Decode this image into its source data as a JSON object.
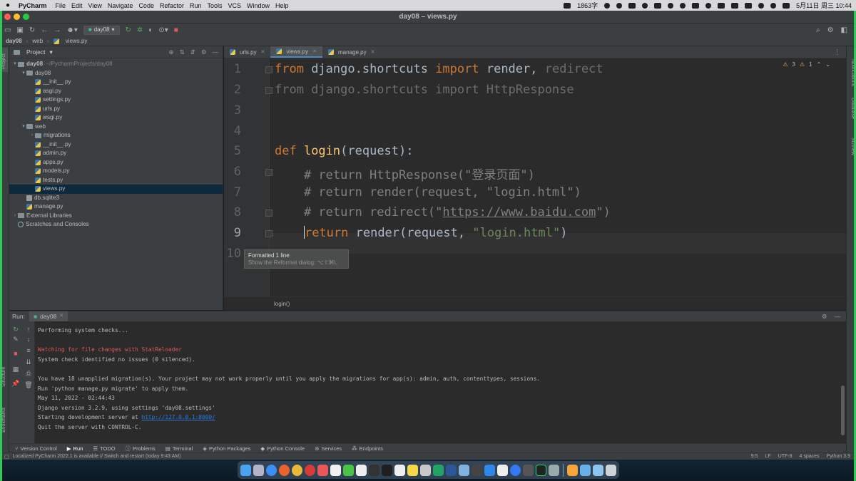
{
  "menubar": {
    "app": "PyCharm",
    "items": [
      "File",
      "Edit",
      "View",
      "Navigate",
      "Code",
      "Refactor",
      "Run",
      "Tools",
      "VCS",
      "Window",
      "Help"
    ],
    "memory": "1863字",
    "datetime": "5月11日 周三 10:44"
  },
  "window": {
    "title": "day08 – views.py"
  },
  "toolbar": {
    "run_config": "day08"
  },
  "breadcrumb": [
    "day08",
    "web",
    "views.py"
  ],
  "project_panel": {
    "title": "Project",
    "tree": [
      {
        "label": "day08",
        "hint": "~/PycharmProjects/day08",
        "depth": 0,
        "kind": "folder",
        "open": true,
        "bold": true
      },
      {
        "label": "day08",
        "hint": "",
        "depth": 1,
        "kind": "folder",
        "open": true
      },
      {
        "label": "__init__.py",
        "hint": "",
        "depth": 2,
        "kind": "py"
      },
      {
        "label": "asgi.py",
        "hint": "",
        "depth": 2,
        "kind": "py"
      },
      {
        "label": "settings.py",
        "hint": "",
        "depth": 2,
        "kind": "py"
      },
      {
        "label": "urls.py",
        "hint": "",
        "depth": 2,
        "kind": "py"
      },
      {
        "label": "wsgi.py",
        "hint": "",
        "depth": 2,
        "kind": "py"
      },
      {
        "label": "web",
        "hint": "",
        "depth": 1,
        "kind": "folder",
        "open": true
      },
      {
        "label": "migrations",
        "hint": "",
        "depth": 2,
        "kind": "folder",
        "open": false
      },
      {
        "label": "__init__.py",
        "hint": "",
        "depth": 2,
        "kind": "py"
      },
      {
        "label": "admin.py",
        "hint": "",
        "depth": 2,
        "kind": "py"
      },
      {
        "label": "apps.py",
        "hint": "",
        "depth": 2,
        "kind": "py"
      },
      {
        "label": "models.py",
        "hint": "",
        "depth": 2,
        "kind": "py"
      },
      {
        "label": "tests.py",
        "hint": "",
        "depth": 2,
        "kind": "py"
      },
      {
        "label": "views.py",
        "hint": "",
        "depth": 2,
        "kind": "py",
        "selected": true
      },
      {
        "label": "db.sqlite3",
        "hint": "",
        "depth": 1,
        "kind": "db"
      },
      {
        "label": "manage.py",
        "hint": "",
        "depth": 1,
        "kind": "py"
      },
      {
        "label": "External Libraries",
        "hint": "",
        "depth": 0,
        "kind": "lib",
        "open": false
      },
      {
        "label": "Scratches and Consoles",
        "hint": "",
        "depth": 0,
        "kind": "scratch"
      }
    ]
  },
  "editor": {
    "tabs": [
      {
        "label": "urls.py",
        "active": false
      },
      {
        "label": "views.py",
        "active": true
      },
      {
        "label": "manage.py",
        "active": false
      }
    ],
    "warnings": "3",
    "weak_warnings": "1",
    "line_numbers": [
      "1",
      "2",
      "3",
      "4",
      "5",
      "6",
      "7",
      "8",
      "9",
      "10"
    ],
    "current_line": "9",
    "code": {
      "l1_from": "from",
      "l1_mod": " django.shortcuts ",
      "l1_import": "import",
      "l1_render": " render,",
      "l1_redirect": " redirect",
      "l2": "from django.shortcuts import HttpResponse",
      "l5_def": "def",
      "l5_name": " login",
      "l5_args": "(request):",
      "l6": "    # return HttpResponse(\"登录页面\")",
      "l7": "    # return render(request, \"login.html\")",
      "l8_pre": "    # return redirect(\"",
      "l8_url": "https://www.baidu.com",
      "l8_post": "\")",
      "l9_return": "return",
      "l9_call": " render(request, ",
      "l9_str": "\"login.html\"",
      "l9_close": ")"
    },
    "tooltip": {
      "title": "Formatted 1 line",
      "hint": "Show the Reformat dialog: ⌥⇧⌘L"
    },
    "breadcrumb": "login()"
  },
  "run_panel": {
    "label": "Run:",
    "tab": "day08",
    "lines": [
      {
        "text": "Performing system checks...",
        "style": "normal"
      },
      {
        "text": "",
        "style": "normal"
      },
      {
        "text": "Watching for file changes with StatReloader",
        "style": "red"
      },
      {
        "text": "System check identified no issues (0 silenced).",
        "style": "normal"
      },
      {
        "text": "",
        "style": "normal"
      },
      {
        "text": "You have 18 unapplied migration(s). Your project may not work properly until you apply the migrations for app(s): admin, auth, contenttypes, sessions.",
        "style": "normal"
      },
      {
        "text": "Run 'python manage.py migrate' to apply them.",
        "style": "normal"
      },
      {
        "text": "May 11, 2022 - 02:44:43",
        "style": "normal"
      },
      {
        "text": "Django version 3.2.9, using settings 'day08.settings'",
        "style": "normal"
      },
      {
        "text": "Starting development server at ",
        "style": "normal",
        "link": "http://127.0.0.1:8000/"
      },
      {
        "text": "Quit the server with CONTROL-C.",
        "style": "normal"
      }
    ]
  },
  "bottom_tabs": [
    "Version Control",
    "Run",
    "TODO",
    "Problems",
    "Terminal",
    "Python Packages",
    "Python Console",
    "Services",
    "Endpoints"
  ],
  "side_labels": {
    "left": [
      "Project",
      "Structure",
      "Bookmarks"
    ],
    "right": [
      "Notifications",
      "Database",
      "SciView"
    ]
  },
  "statusbar": {
    "message": "Localized PyCharm 2022.1 is available // Switch and restart (today 9:43 AM)",
    "position": "9:5",
    "line_sep": "LF",
    "encoding": "UTF-8",
    "indent": "4 spaces",
    "interpreter": "Python 3.9"
  }
}
